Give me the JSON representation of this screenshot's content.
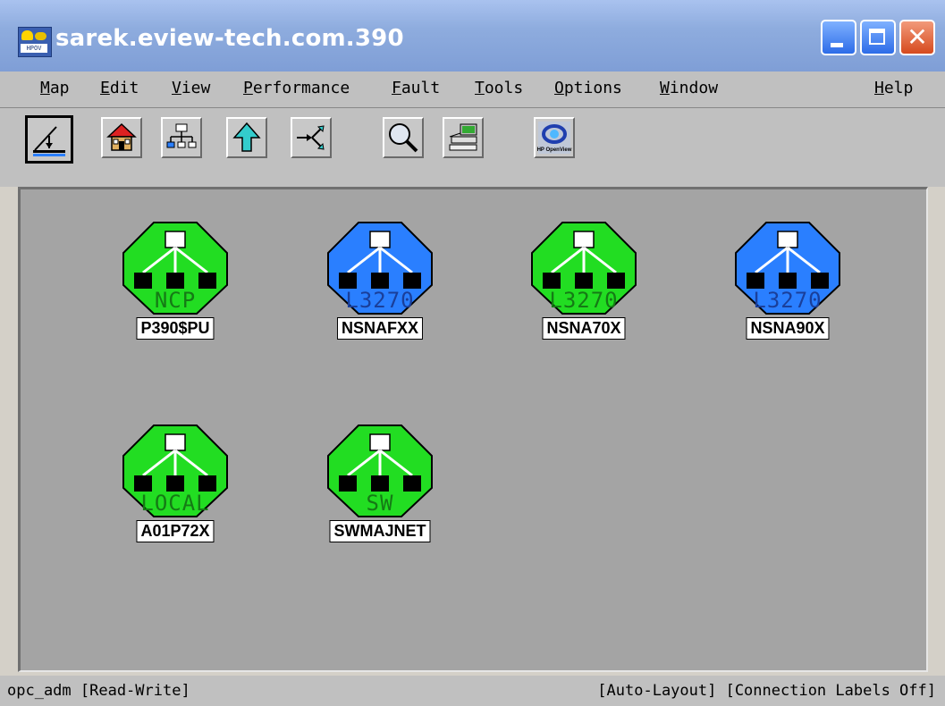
{
  "window": {
    "title": "sarek.eview-tech.com.390"
  },
  "menu": {
    "items": [
      {
        "label": "Map",
        "u": "M",
        "rest": "ap"
      },
      {
        "label": "Edit",
        "u": "E",
        "rest": "dit"
      },
      {
        "label": "View",
        "u": "V",
        "rest": "iew"
      },
      {
        "label": "Performance",
        "u": "P",
        "rest": "erformance"
      },
      {
        "label": "Fault",
        "u": "F",
        "rest": "ault"
      },
      {
        "label": "Tools",
        "u": "T",
        "rest": "ools"
      },
      {
        "label": "Options",
        "u": "O",
        "rest": "ptions"
      },
      {
        "label": "Window",
        "u": "W",
        "rest": "indow"
      },
      {
        "label": "Help",
        "u": "H",
        "rest": "elp"
      }
    ]
  },
  "toolbar": {
    "buttons": [
      {
        "icon": "map-draw-icon",
        "active": true
      },
      {
        "icon": "home-icon"
      },
      {
        "icon": "hierarchy-icon"
      },
      {
        "icon": "up-arrow-icon"
      },
      {
        "icon": "shortcuts-icon"
      },
      {
        "icon": "magnifier-icon"
      },
      {
        "icon": "device-icon"
      },
      {
        "icon": "hp-openview-icon",
        "caption": "HP OpenView"
      }
    ]
  },
  "map": {
    "nodes": [
      {
        "name": "P390$PU",
        "class": "NCP",
        "color": "#22dd22"
      },
      {
        "name": "NSNAFXX",
        "class": "L3270",
        "color": "#2a7fff"
      },
      {
        "name": "NSNA70X",
        "class": "L3270",
        "color": "#22dd22"
      },
      {
        "name": "NSNA90X",
        "class": "L3270",
        "color": "#2a7fff"
      },
      {
        "name": "A01P72X",
        "class": "LOCAL",
        "color": "#22dd22"
      },
      {
        "name": "SWMAJNET",
        "class": "SW",
        "color": "#22dd22"
      }
    ]
  },
  "status": {
    "left": "opc_adm [Read-Write]",
    "right": "[Auto-Layout] [Connection Labels Off]"
  }
}
